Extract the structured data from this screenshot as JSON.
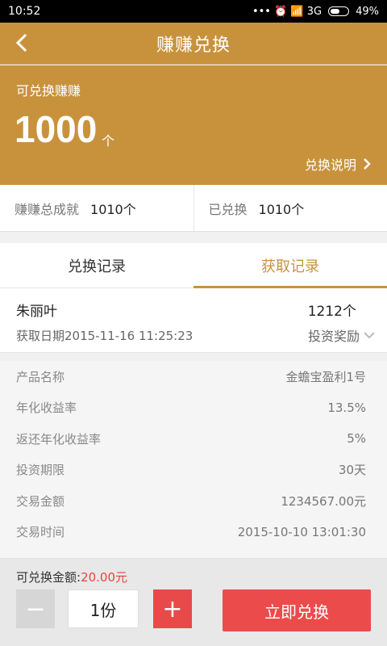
{
  "status_bar": {
    "time": "10:52",
    "icons": "••• ⏰ 📶 3G",
    "battery": "49%"
  },
  "header": {
    "title": "赚赚兑换"
  },
  "balance": {
    "label": "可兑换赚赚",
    "amount": "1000",
    "unit": "个",
    "explain_link": "兑换说明"
  },
  "summary": {
    "total_label": "赚赚总成就",
    "total_value": "1010个",
    "redeemed_label": "已兑换",
    "redeemed_value": "1010个"
  },
  "tabs": [
    {
      "label": "兑换记录",
      "active": false
    },
    {
      "label": "获取记录",
      "active": true
    }
  ],
  "record": {
    "name": "朱丽叶",
    "count": "1212个",
    "date": "获取日期2015-11-16  11:25:23",
    "source": "投资奖励"
  },
  "details": [
    {
      "label": "产品名称",
      "value": "金蟾宝盈利1号"
    },
    {
      "label": "年化收益率",
      "value": "13.5%"
    },
    {
      "label": "返还年化收益率",
      "value": "5%"
    },
    {
      "label": "投资期限",
      "value": "30天"
    },
    {
      "label": "交易金额",
      "value": "1234567.00元"
    },
    {
      "label": "交易时间",
      "value": "2015-10-10  13:01:30"
    }
  ],
  "bottom": {
    "available_label": "可兑换金额:",
    "available_value": "20.00元",
    "quantity": "1份",
    "minus": "−",
    "plus": "+",
    "redeem_label": "立即兑换"
  },
  "colors": {
    "brand": "#c8923d",
    "accent_red": "#ec4b4b"
  }
}
